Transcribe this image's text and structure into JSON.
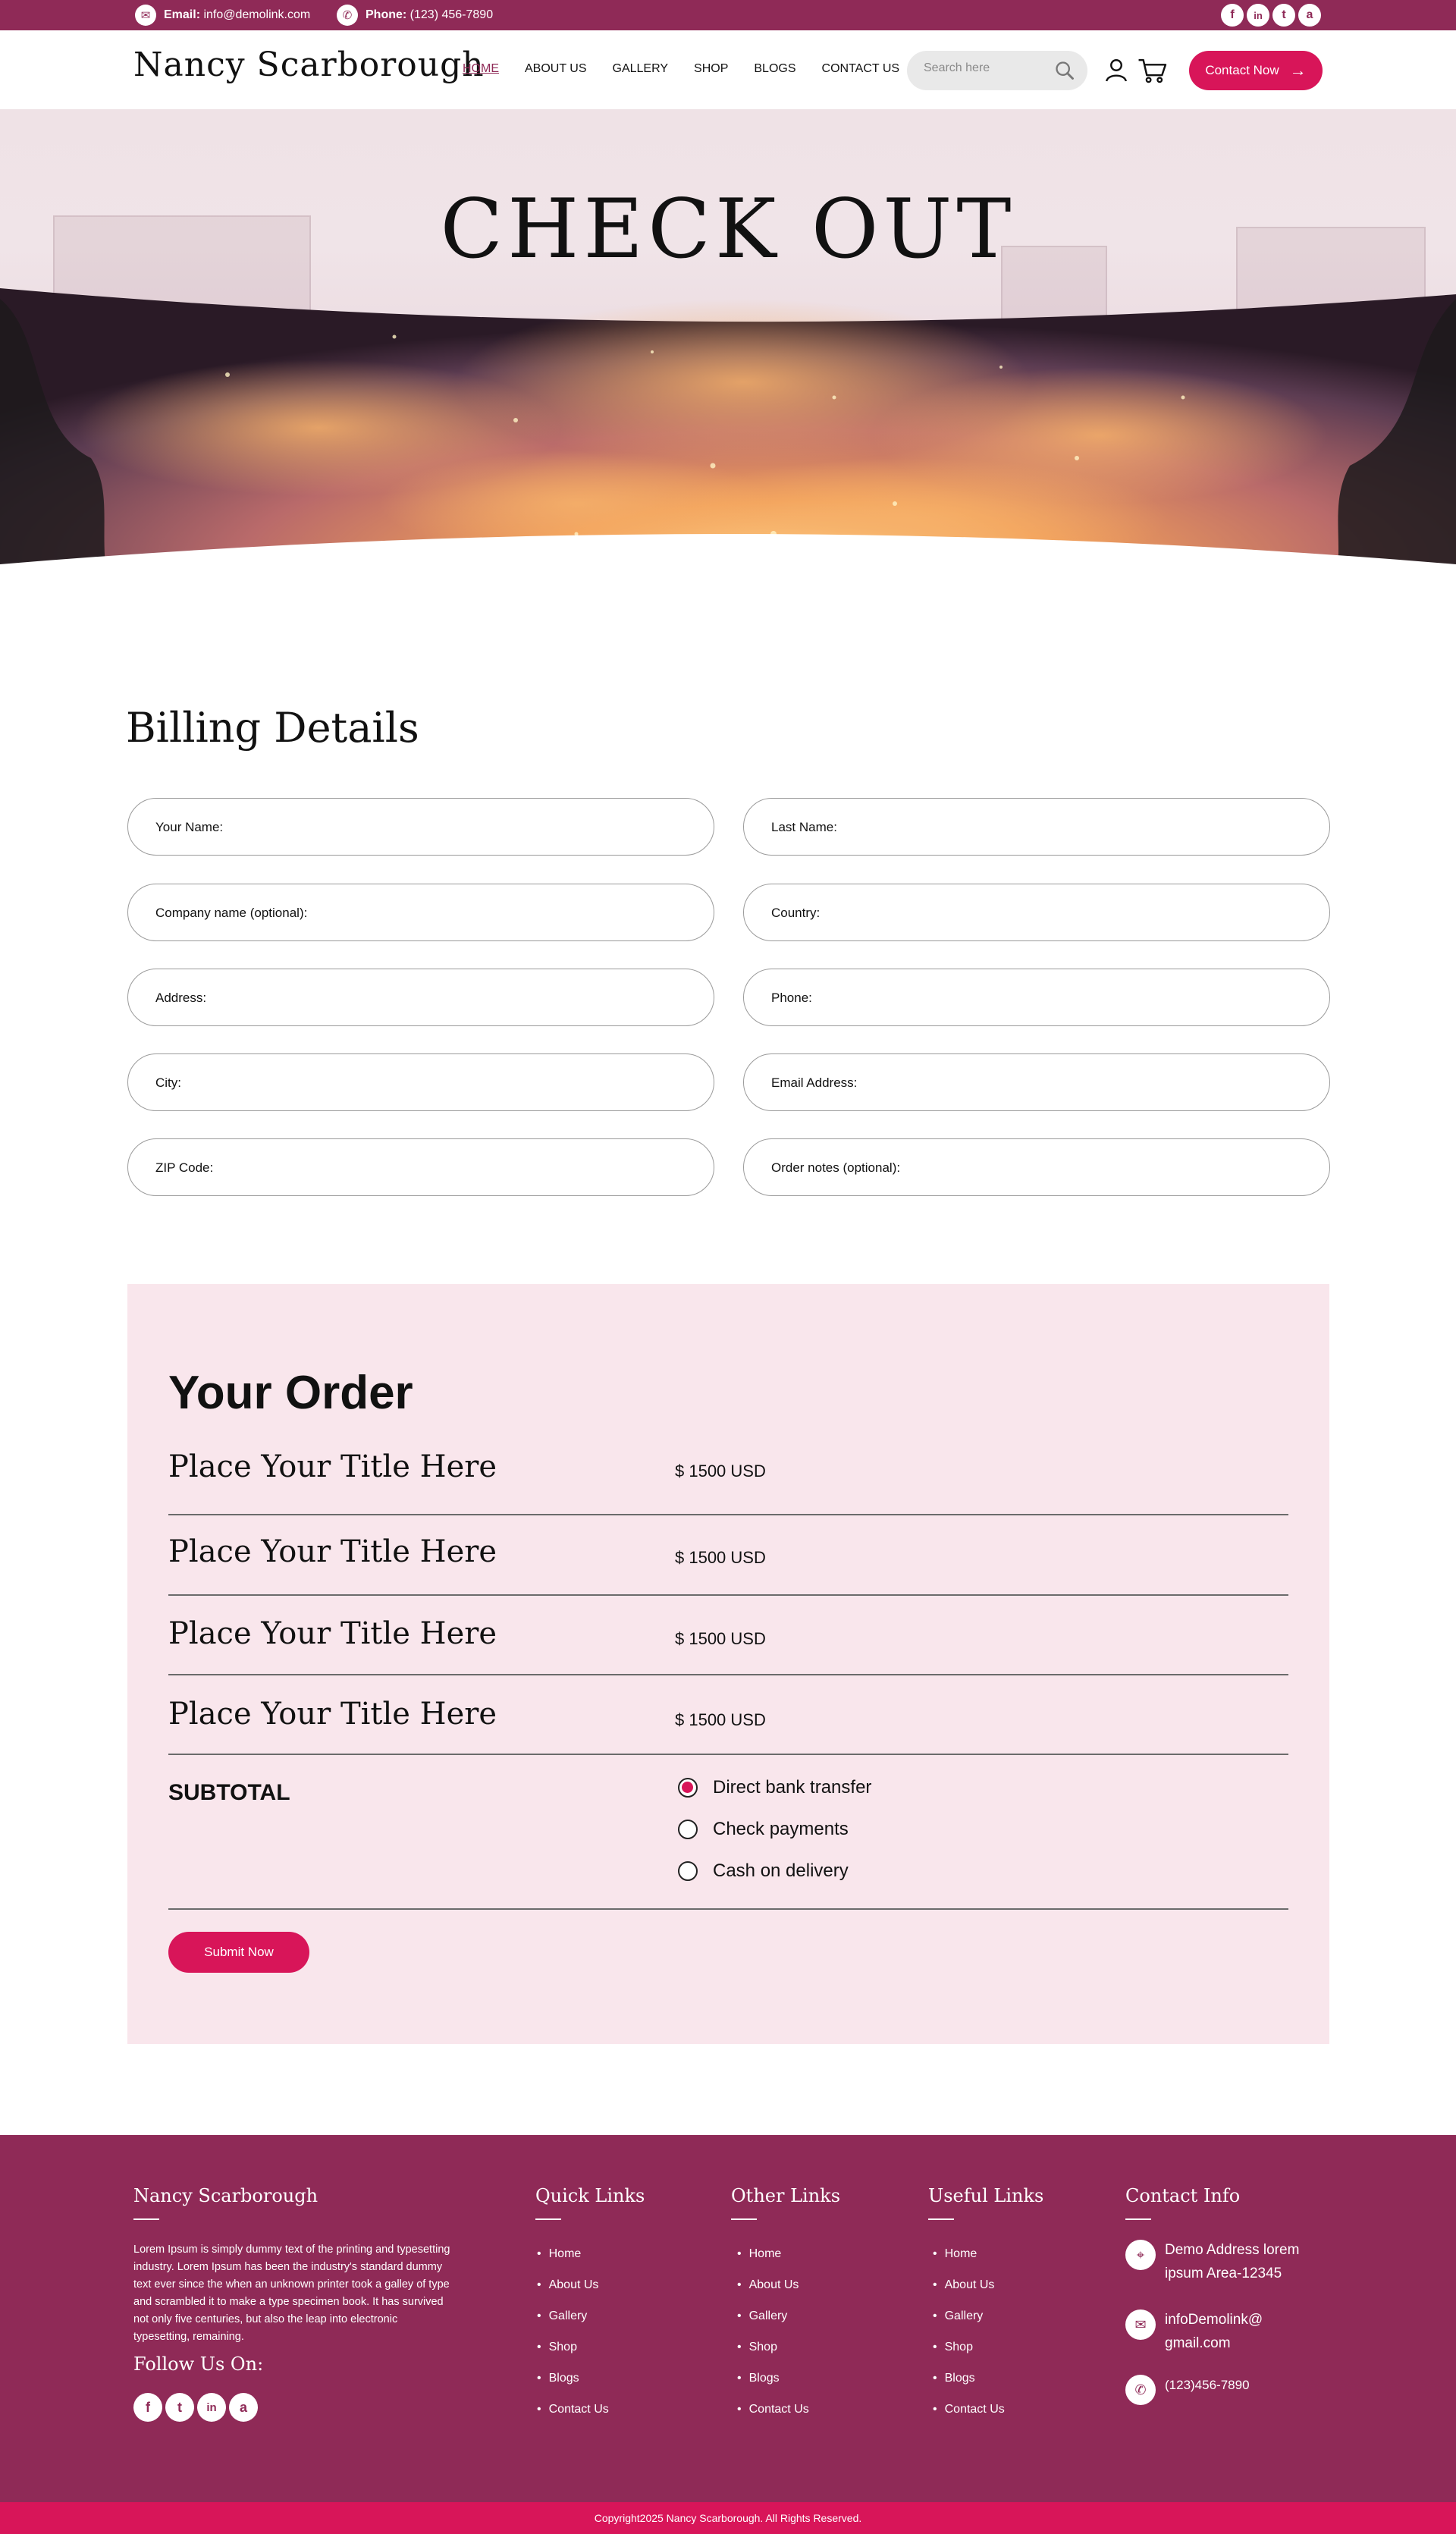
{
  "topbar": {
    "email_label": "Email:",
    "email_value": "info@demolink.com",
    "phone_label": "Phone:",
    "phone_value": "(123) 456-7890",
    "socials": [
      "f",
      "in",
      "t",
      "a"
    ]
  },
  "header": {
    "logo": "Nancy Scarborough",
    "nav": [
      "HOME",
      "ABOUT US",
      "GALLERY",
      "SHOP",
      "BLOGS",
      "CONTACT US"
    ],
    "search_placeholder": "Search here",
    "contact_button": "Contact Now"
  },
  "hero": {
    "title": "CHECK OUT"
  },
  "billing": {
    "title": "Billing Details",
    "fields_left": [
      "Your Name:",
      "Company name (optional):",
      "Address:",
      "City:",
      "ZIP Code:"
    ],
    "fields_right": [
      "Last Name:",
      "Country:",
      "Phone:",
      "Email Address:",
      "Order notes (optional):"
    ]
  },
  "order": {
    "title": "Your Order",
    "items": [
      {
        "title": "Place Your Title Here",
        "price": "$ 1500 USD"
      },
      {
        "title": "Place Your Title Here",
        "price": "$ 1500 USD"
      },
      {
        "title": "Place Your Title Here",
        "price": "$ 1500 USD"
      },
      {
        "title": "Place Your Title Here",
        "price": "$ 1500 USD"
      }
    ],
    "subtotal_label": "SUBTOTAL",
    "payment_options": [
      "Direct bank transfer",
      "Check payments",
      "Cash on delivery"
    ],
    "selected_payment": "Direct bank transfer",
    "submit_label": "Submit Now"
  },
  "footer": {
    "brand": "Nancy Scarborough",
    "about": "Lorem Ipsum is simply dummy text of the printing and typesetting industry. Lorem Ipsum has been the industry's standard dummy text ever since the  when an unknown printer took a galley of type and scrambled it to make a type specimen book. It has survived not only five centuries, but also the leap into electronic typesetting, remaining.",
    "follow_label": "Follow Us On:",
    "quick_links": {
      "title": "Quick Links",
      "items": [
        "Home",
        "About Us",
        "Gallery",
        "Shop",
        "Blogs",
        "Contact Us"
      ]
    },
    "other_links": {
      "title": "Other Links",
      "items": [
        "Home",
        "About Us",
        "Gallery",
        "Shop",
        "Blogs",
        "Contact Us"
      ]
    },
    "useful_links": {
      "title": "Useful Links",
      "items": [
        "Home",
        "About Us",
        "Gallery",
        "Shop",
        "Blogs",
        "Contact Us"
      ]
    },
    "contact_info": {
      "title": "Contact Info",
      "address_line1": "Demo Address  lorem",
      "address_line2": "ipsum Area-12345",
      "email_line1": "infoDemolink@",
      "email_line2": "gmail.com",
      "phone": "(123)456-7890"
    },
    "copyright": "Copyright2025 Nancy Scarborough. All Rights Reserved."
  },
  "colors": {
    "brand_plum": "#8f2a57",
    "accent_pink": "#d81559",
    "order_bg": "#f9e6ec"
  }
}
